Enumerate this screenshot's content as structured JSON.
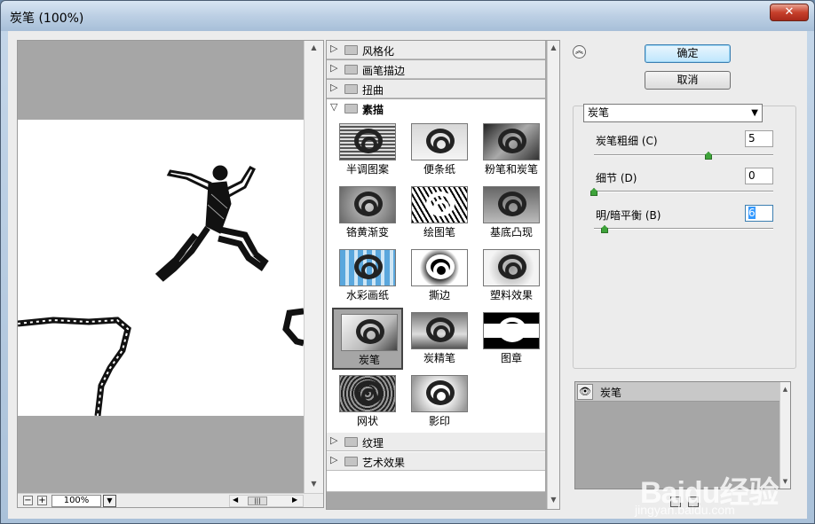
{
  "window": {
    "title": "炭笔 (100%)",
    "close_label": "✕"
  },
  "preview": {
    "zoom": "100%",
    "zoom_out": "−",
    "zoom_in": "+"
  },
  "categories_top": [
    {
      "label": "风格化",
      "state": "collapsed"
    },
    {
      "label": "画笔描边",
      "state": "collapsed"
    },
    {
      "label": "扭曲",
      "state": "collapsed"
    }
  ],
  "category_open": {
    "label": "素描",
    "state": "expanded"
  },
  "filters": [
    {
      "label": "半调图案",
      "style": "halftone"
    },
    {
      "label": "便条纸",
      "style": "notepaper"
    },
    {
      "label": "粉笔和炭笔",
      "style": "chalk"
    },
    {
      "label": "铬黄渐变",
      "style": "chrome"
    },
    {
      "label": "绘图笔",
      "style": "pen"
    },
    {
      "label": "基底凸现",
      "style": "bas"
    },
    {
      "label": "水彩画纸",
      "style": "watercolor"
    },
    {
      "label": "撕边",
      "style": "torn"
    },
    {
      "label": "塑料效果",
      "style": "plaster"
    },
    {
      "label": "炭笔",
      "style": "charcoal",
      "selected": true
    },
    {
      "label": "炭精笔",
      "style": "conte"
    },
    {
      "label": "图章",
      "style": "stamp"
    },
    {
      "label": "网状",
      "style": "reticulation"
    },
    {
      "label": "影印",
      "style": "photocopy"
    }
  ],
  "categories_bottom": [
    {
      "label": "纹理",
      "state": "collapsed"
    },
    {
      "label": "艺术效果",
      "state": "collapsed"
    }
  ],
  "buttons": {
    "ok": "确定",
    "cancel": "取消"
  },
  "filter_select": {
    "value": "炭笔"
  },
  "params": [
    {
      "label": "炭笔粗细 (C)",
      "value": "5",
      "level": 0.66
    },
    {
      "label": "细节 (D)",
      "value": "0",
      "level": 0.0
    },
    {
      "label": "明/暗平衡 (B)",
      "value": "6",
      "level": 0.06
    }
  ],
  "effect_layers": {
    "name": "炭笔"
  },
  "watermark": {
    "text": "Baidu经验",
    "url": "jingyan.baidu.com"
  }
}
